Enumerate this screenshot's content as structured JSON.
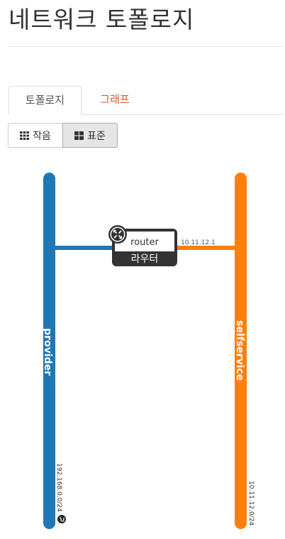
{
  "page": {
    "title": "네트워크 토폴로지"
  },
  "tabs": [
    {
      "label": "토폴로지",
      "active": true
    },
    {
      "label": "그래프",
      "active": false
    }
  ],
  "view_toggle": {
    "small_label": "작음",
    "normal_label": "표준",
    "selected": "normal"
  },
  "topology": {
    "networks": [
      {
        "name": "provider",
        "cidr": "192.168.0.0/24",
        "color": "#1f77b4",
        "external": true
      },
      {
        "name": "selfservice",
        "cidr": "10.11.12.0/24",
        "color": "#ff7f0e",
        "external": false
      }
    ],
    "router": {
      "name": "router",
      "type_label": "라우터",
      "gateway_ip": "10.11.12.1"
    }
  },
  "colors": {
    "provider": "#1f77b4",
    "selfservice": "#ff7f0e",
    "tab_link": "#e0541b",
    "router_box": "#333333"
  },
  "icons": {
    "small_view": "grid-small-icon",
    "normal_view": "grid-large-icon",
    "router": "router-icon",
    "external": "globe-icon"
  }
}
